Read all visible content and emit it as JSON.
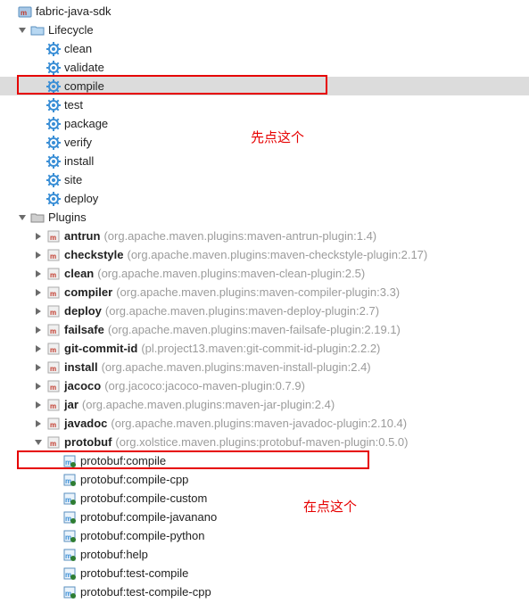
{
  "project": {
    "name": "fabric-java-sdk"
  },
  "lifecycle": {
    "label": "Lifecycle",
    "phases": [
      "clean",
      "validate",
      "compile",
      "test",
      "package",
      "verify",
      "install",
      "site",
      "deploy"
    ]
  },
  "plugins": {
    "label": "Plugins",
    "items": [
      {
        "name": "antrun",
        "hint": "(org.apache.maven.plugins:maven-antrun-plugin:1.4)"
      },
      {
        "name": "checkstyle",
        "hint": "(org.apache.maven.plugins:maven-checkstyle-plugin:2.17)"
      },
      {
        "name": "clean",
        "hint": "(org.apache.maven.plugins:maven-clean-plugin:2.5)"
      },
      {
        "name": "compiler",
        "hint": "(org.apache.maven.plugins:maven-compiler-plugin:3.3)"
      },
      {
        "name": "deploy",
        "hint": "(org.apache.maven.plugins:maven-deploy-plugin:2.7)"
      },
      {
        "name": "failsafe",
        "hint": "(org.apache.maven.plugins:maven-failsafe-plugin:2.19.1)"
      },
      {
        "name": "git-commit-id",
        "hint": "(pl.project13.maven:git-commit-id-plugin:2.2.2)"
      },
      {
        "name": "install",
        "hint": "(org.apache.maven.plugins:maven-install-plugin:2.4)"
      },
      {
        "name": "jacoco",
        "hint": "(org.jacoco:jacoco-maven-plugin:0.7.9)"
      },
      {
        "name": "jar",
        "hint": "(org.apache.maven.plugins:maven-jar-plugin:2.4)"
      },
      {
        "name": "javadoc",
        "hint": "(org.apache.maven.plugins:maven-javadoc-plugin:2.10.4)"
      },
      {
        "name": "protobuf",
        "hint": "(org.xolstice.maven.plugins:protobuf-maven-plugin:0.5.0)"
      }
    ],
    "protobuf_goals": [
      "protobuf:compile",
      "protobuf:compile-cpp",
      "protobuf:compile-custom",
      "protobuf:compile-javanano",
      "protobuf:compile-python",
      "protobuf:help",
      "protobuf:test-compile",
      "protobuf:test-compile-cpp"
    ]
  },
  "annotations": {
    "first": "先点这个",
    "second": "在点这个"
  },
  "colors": {
    "highlight": "#e60000",
    "hint": "#9b9b9b",
    "selected_bg": "#dcdcdc",
    "icon_blue": "#3b8fd6"
  }
}
